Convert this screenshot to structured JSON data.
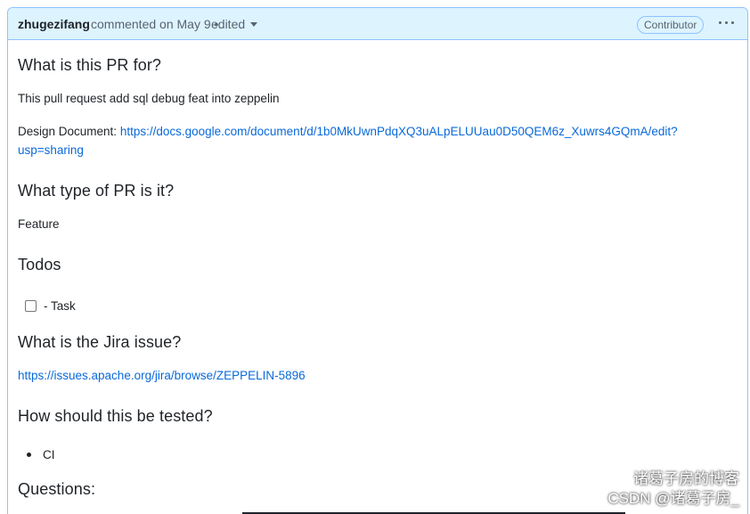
{
  "header": {
    "author": "zhugezifang",
    "commented_prefix": "commented on",
    "date": "May 9",
    "separator": "•",
    "edited_label": "edited",
    "role_badge": "Contributor",
    "more_icon": "kebab-horizontal-icon"
  },
  "body": {
    "h_pr_for": "What is this PR for?",
    "pr_for_text": "This pull request add sql debug feat into zeppelin",
    "design_label": "Design Document:",
    "design_link_line1": "https://docs.google.com/document/d/1b0MkUwnPdqXQ3uALpELUUau0D50QEM6z_Xuwrs4GQmA/edit?",
    "design_link_line2": "usp=sharing",
    "h_pr_type": "What type of PR is it?",
    "pr_type_text": "Feature",
    "h_todos": "Todos",
    "todo_item": "- Task",
    "h_jira": "What is the Jira issue?",
    "jira_link": "https://issues.apache.org/jira/browse/ZEPPELIN-5896",
    "h_tested": "How should this be tested?",
    "tested_item": "CI",
    "h_questions": "Questions:"
  },
  "watermark": {
    "line1": "诸葛子房的博客",
    "line2": "CSDN @诸葛子房_",
    "logo_icon": "wechat-logo-icon"
  },
  "colors": {
    "header_bg": "#ddf4ff",
    "border": "#8ec2ff",
    "link": "#0969da",
    "text": "#1f2328",
    "muted": "#59636e"
  }
}
